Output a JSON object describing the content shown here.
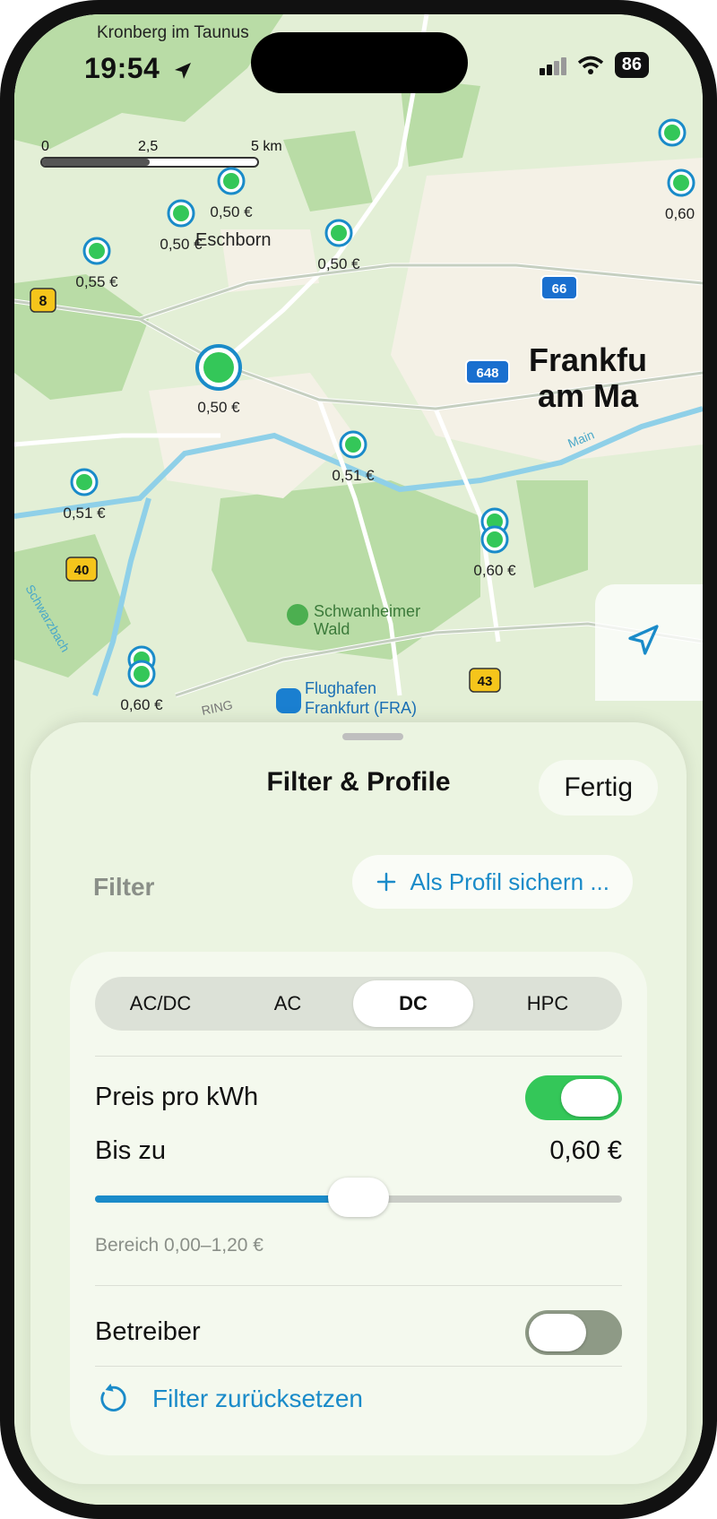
{
  "status_bar": {
    "time": "19:54",
    "battery": "86"
  },
  "map": {
    "places": {
      "kronberg": "Kronberg im Taunus",
      "eschborn": "Eschborn",
      "frankfurt_line1": "Frankfu",
      "frankfurt_line2": "am Ma",
      "schwanheimer_line1": "Schwanheimer",
      "schwanheimer_line2": "Wald",
      "airport_line1": "Flughafen",
      "airport_line2": "Frankfurt (FRA)",
      "river_main": "Main",
      "river_schwarzbach": "Schwarzbach",
      "ring": "RING"
    },
    "scale": {
      "labels": [
        "0",
        "2,5",
        "5 km"
      ]
    },
    "road_shields": {
      "a8": "8",
      "a66": "66",
      "b648": "648",
      "a40": "40",
      "a43": "43"
    },
    "prices": {
      "p1": "0,50 €",
      "p2": "0,50 €",
      "p3": "0,55 €",
      "p4": "0,50 €",
      "p5": "0,50 €",
      "p6": "0,51 €",
      "p7": "0,51 €",
      "p8": "0,60 €",
      "p9": "0,60 €",
      "p10": "0,60"
    }
  },
  "sheet": {
    "title": "Filter & Profile",
    "done": "Fertig",
    "section_label": "Filter",
    "save_profile": "Als Profil sichern ...",
    "segments": [
      "AC/DC",
      "AC",
      "DC",
      "HPC"
    ],
    "selected_segment": "DC",
    "price_per_kwh": {
      "label": "Preis pro kWh",
      "enabled": true
    },
    "max_price": {
      "label": "Bis zu",
      "value": "0,60 €",
      "fraction": 0.5
    },
    "range_note": "Bereich 0,00–1,20 €",
    "operator": {
      "label": "Betreiber",
      "enabled": false
    },
    "reset": "Filter zurücksetzen"
  },
  "colors": {
    "accent": "#1a8bc9",
    "toggle_on": "#34c759",
    "toggle_off": "#8e9a86",
    "charger": "#34c759"
  }
}
